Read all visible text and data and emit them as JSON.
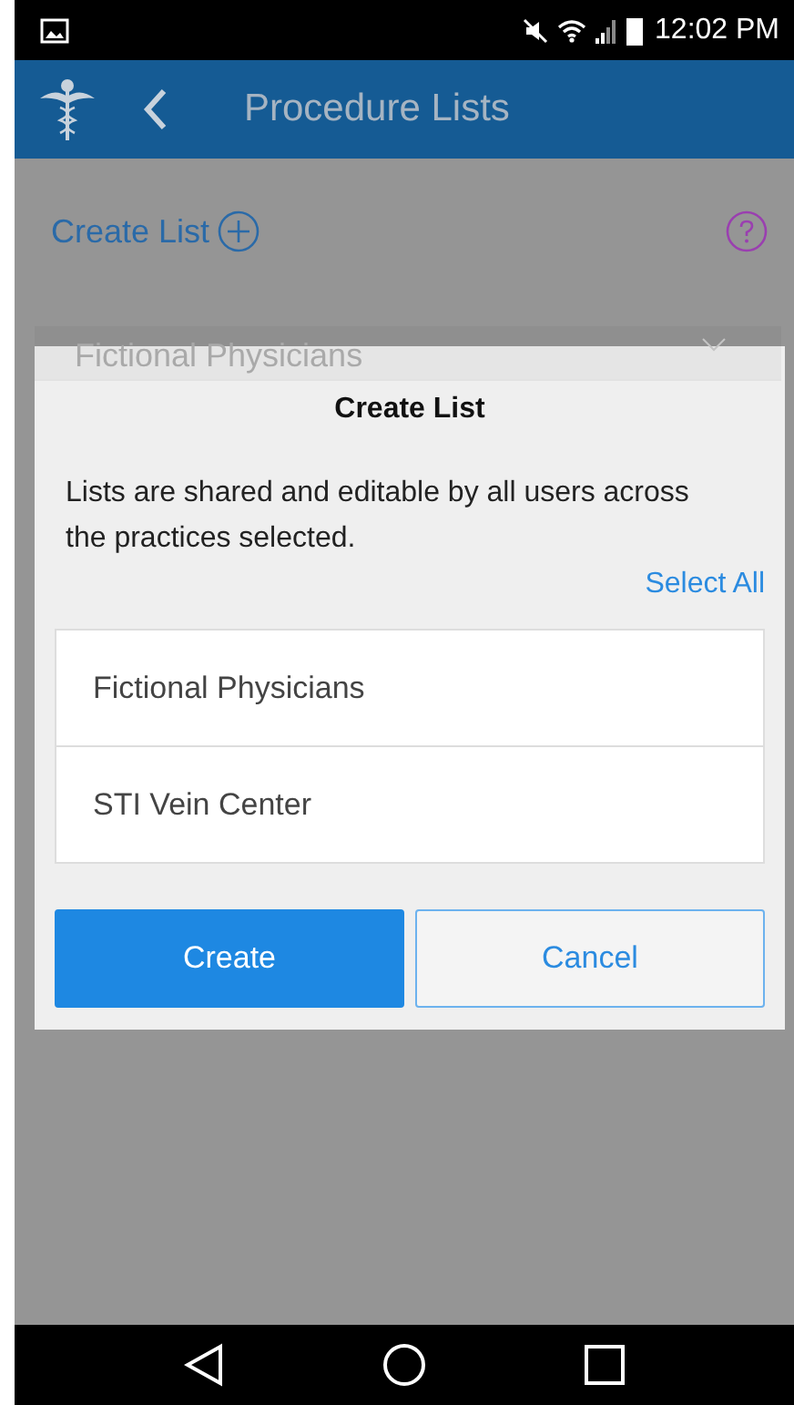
{
  "status_bar": {
    "time": "12:02 PM"
  },
  "header": {
    "title": "Procedure Lists"
  },
  "toolbar": {
    "create_label": "Create List"
  },
  "background_select": {
    "value": "Fictional Physicians"
  },
  "dialog": {
    "title": "Create List",
    "message": "Lists are shared and editable by all users across the practices selected.",
    "select_all": "Select All",
    "practices": [
      {
        "name": "Fictional Physicians"
      },
      {
        "name": "STI Vein Center"
      }
    ],
    "buttons": [
      {
        "label": "Create",
        "kind": "primary"
      },
      {
        "label": "Cancel",
        "kind": "secondary"
      }
    ]
  }
}
